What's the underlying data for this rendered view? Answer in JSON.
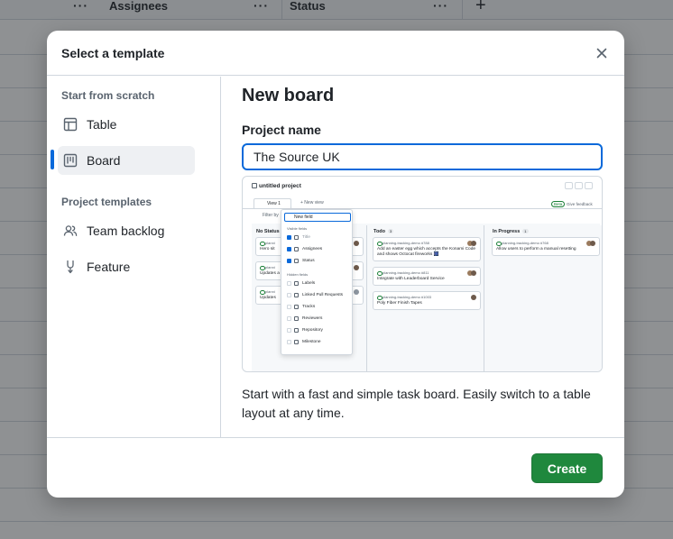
{
  "background": {
    "columns": [
      "Assignees",
      "Status"
    ],
    "add_column_icon": "plus-icon",
    "more_icon": "kebab-horizontal-icon"
  },
  "dialog": {
    "title": "Select a template",
    "close_icon": "x-icon",
    "sidebar": {
      "scratch_heading": "Start from scratch",
      "scratch_items": [
        {
          "label": "Table",
          "icon": "table-icon",
          "active": false
        },
        {
          "label": "Board",
          "icon": "project-board-icon",
          "active": true
        }
      ],
      "templates_heading": "Project templates",
      "template_items": [
        {
          "label": "Team backlog",
          "icon": "people-icon"
        },
        {
          "label": "Feature",
          "icon": "feature-icon"
        }
      ]
    },
    "main": {
      "title": "New board",
      "project_name_label": "Project name",
      "project_name_value": "The Source UK",
      "preview": {
        "project_title": "untitled project",
        "view_tab": "View 1",
        "new_view": "+ New view",
        "beta_badge": "Beta",
        "feedback": "Give feedback",
        "filter": "Filter by",
        "columns": [
          {
            "name": "No Status",
            "count": ""
          },
          {
            "name": "Todo",
            "count": "3"
          },
          {
            "name": "In Progress",
            "count": "1"
          }
        ],
        "col1_cards": [
          "Hero sit",
          "Updates a",
          "Updates"
        ],
        "col1_ref": "planni",
        "todo_cards": [
          {
            "ref": "planning-tracking-demo #788",
            "text": "Add an easter egg which accepts the Konami Code and shows Octocat fireworks 🎆"
          },
          {
            "ref": "planning-tracking-demo #811",
            "text": "Integrate with Leaderboard Service"
          },
          {
            "ref": "planning-tracking-demo #1003",
            "text": "Poly Fiber Finish Tapes"
          }
        ],
        "progress_cards": [
          {
            "ref": "planning-tracking-demo #768",
            "text": "Allow users to perform a manual resetting"
          }
        ],
        "menu": {
          "input": "New field",
          "visible_heading": "Visible fields",
          "visible": [
            "Title",
            "Assignees",
            "Status"
          ],
          "hidden_heading": "Hidden fields",
          "hidden": [
            "Labels",
            "Linked Pull Requests",
            "Tracks",
            "Reviewers",
            "Repository",
            "Milestone"
          ]
        }
      },
      "description": "Start with a fast and simple task board. Easily switch to a table layout at any time."
    },
    "footer": {
      "create_label": "Create"
    }
  }
}
